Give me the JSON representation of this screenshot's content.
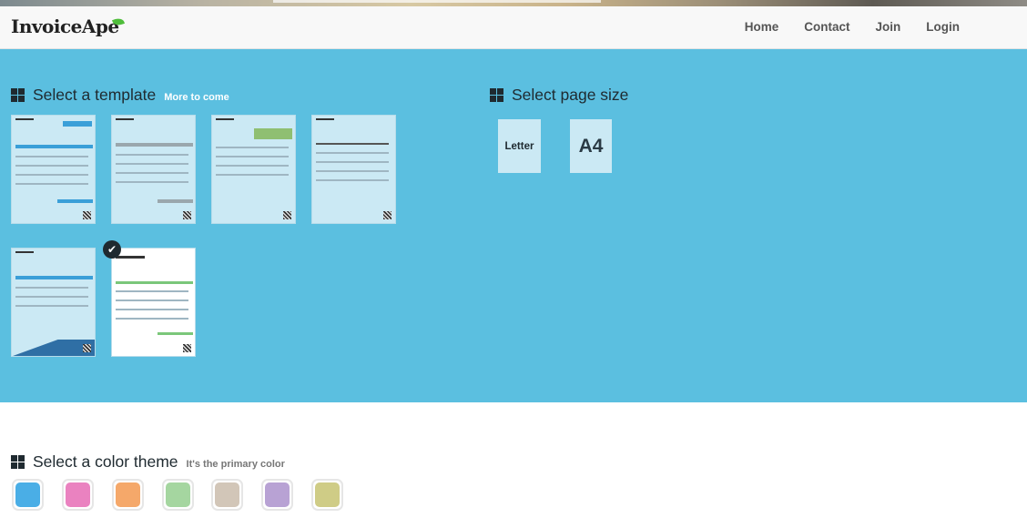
{
  "app": {
    "brand": "InvoiceApe"
  },
  "nav": {
    "items": [
      {
        "label": "Home"
      },
      {
        "label": "Contact"
      },
      {
        "label": "Join"
      },
      {
        "label": "Login"
      }
    ]
  },
  "template_section": {
    "title": "Select a template",
    "subtitle": "More to come",
    "templates": [
      {
        "style": "blue-header",
        "selected": false
      },
      {
        "style": "gray-bands",
        "selected": false
      },
      {
        "style": "green-box",
        "selected": false
      },
      {
        "style": "plain-lines",
        "selected": false
      },
      {
        "style": "blue-wave",
        "selected": false
      },
      {
        "style": "green-invoice",
        "selected": true
      }
    ],
    "selected_icon": "checkmark-icon"
  },
  "page_size_section": {
    "title": "Select page size",
    "options": [
      {
        "label": "Letter"
      },
      {
        "label": "A4"
      }
    ]
  },
  "color_section": {
    "title": "Select a color theme",
    "subtitle": "It's the primary color",
    "colors": [
      "#4aaee6",
      "#ea82c0",
      "#f5a86a",
      "#a5d6a0",
      "#d2c6b8",
      "#b8a2d4",
      "#cfcc86"
    ]
  },
  "theme": {
    "accent": "#5bbfe0",
    "navbar_bg": "#f8f8f8",
    "thumb_bg": "#cbe9f4"
  }
}
